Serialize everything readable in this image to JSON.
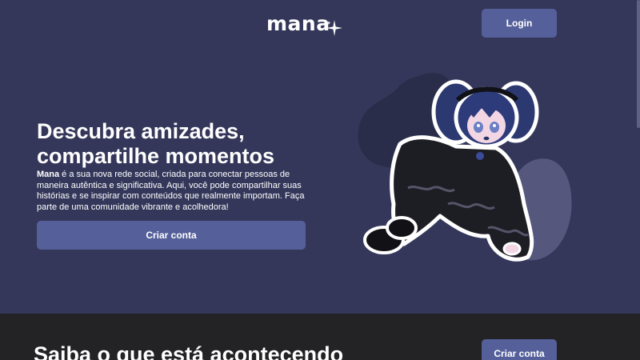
{
  "header": {
    "logo_text": "mana",
    "login_label": "Login"
  },
  "hero": {
    "title_line1": "Descubra amizades,",
    "title_line2": "compartilhe momentos",
    "description_brand": "Mana",
    "description_rest": " é a sua nova rede social, criada para conectar pessoas de maneira autêntica e significativa. Aqui, você pode compartilhar suas histórias e se inspirar com conteúdos que realmente importam. Faça parte de uma comunidade vibrante e acolhedora!",
    "create_account_label": "Criar conta"
  },
  "section2": {
    "title": "Saiba o que está acontecendo",
    "create_account_label": "Criar conta"
  },
  "colors": {
    "background": "#34375a",
    "button": "#55609a",
    "footer_section": "#232325",
    "blob_dark": "#2a2d49",
    "blob_light": "#55587c"
  }
}
